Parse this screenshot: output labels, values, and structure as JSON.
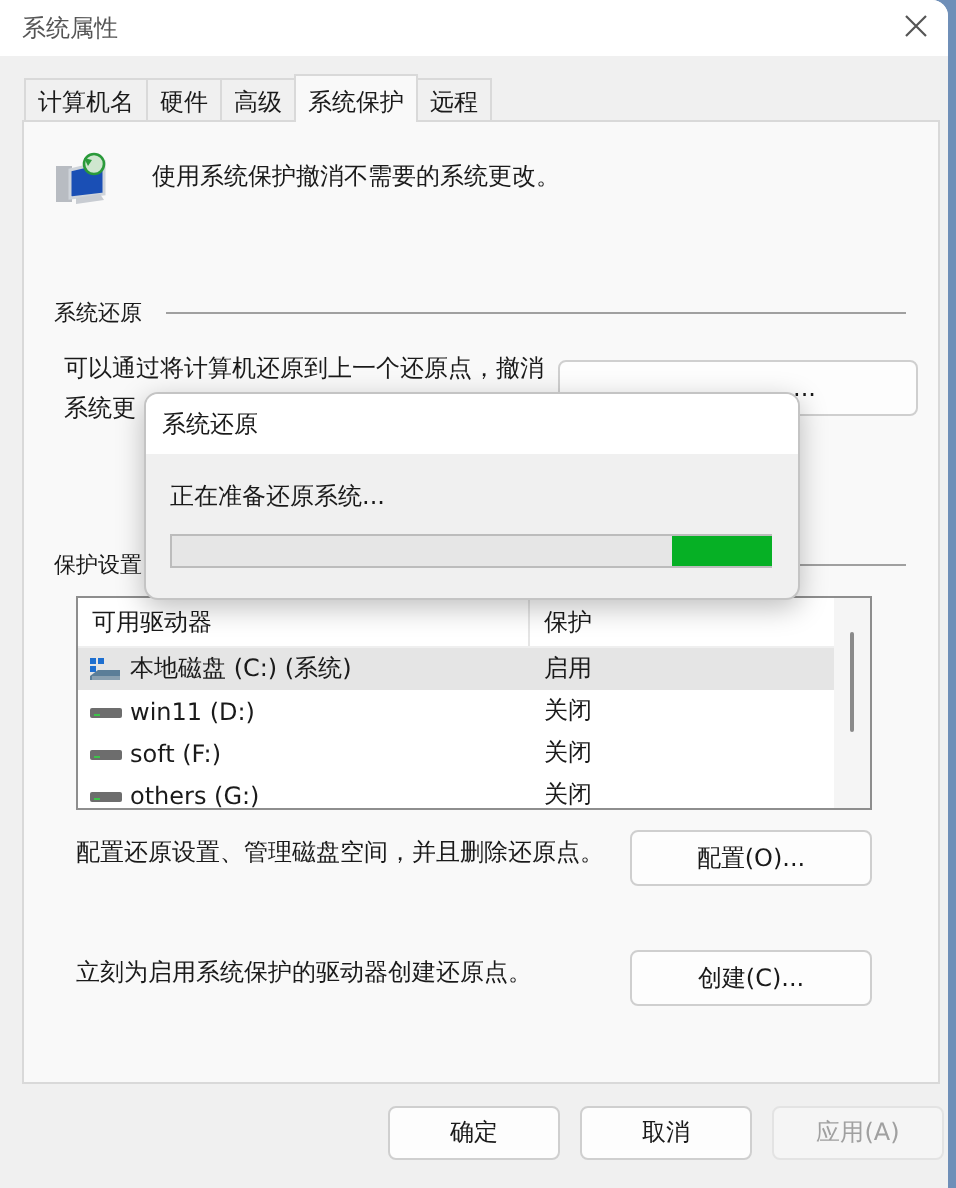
{
  "window": {
    "title": "系统属性"
  },
  "tabs": [
    {
      "label": "计算机名",
      "selected": false
    },
    {
      "label": "硬件",
      "selected": false
    },
    {
      "label": "高级",
      "selected": false
    },
    {
      "label": "系统保护",
      "selected": true
    },
    {
      "label": "远程",
      "selected": false
    }
  ],
  "intro": "使用系统保护撤消不需要的系统更改。",
  "restore_section": {
    "heading": "系统还原",
    "text_lines": [
      "可以通过将计算机还原到上一个还原点，撤消",
      "系统更"
    ],
    "button": "..."
  },
  "protection_section": {
    "heading": "保护设置",
    "columns": [
      "可用驱动器",
      "保护"
    ],
    "rows": [
      {
        "drive": "本地磁盘 (C:) (系统)",
        "protection": "启用",
        "kind": "system",
        "selected": true
      },
      {
        "drive": "win11 (D:)",
        "protection": "关闭",
        "kind": "disk",
        "selected": false
      },
      {
        "drive": "soft (F:)",
        "protection": "关闭",
        "kind": "disk",
        "selected": false
      },
      {
        "drive": "others (G:)",
        "protection": "关闭",
        "kind": "disk",
        "selected": false
      }
    ]
  },
  "configure": {
    "text": "配置还原设置、管理磁盘空间，并且删除还原点。",
    "button": "配置(O)..."
  },
  "create": {
    "text": "立刻为启用系统保护的驱动器创建还原点。",
    "button": "创建(C)..."
  },
  "buttons": [
    {
      "label": "确定",
      "disabled": false
    },
    {
      "label": "取消",
      "disabled": false
    },
    {
      "label": "应用(A)",
      "disabled": true
    }
  ],
  "dialog": {
    "title": "系统还原",
    "message": "正在准备还原系统...",
    "indeterminate": true
  }
}
